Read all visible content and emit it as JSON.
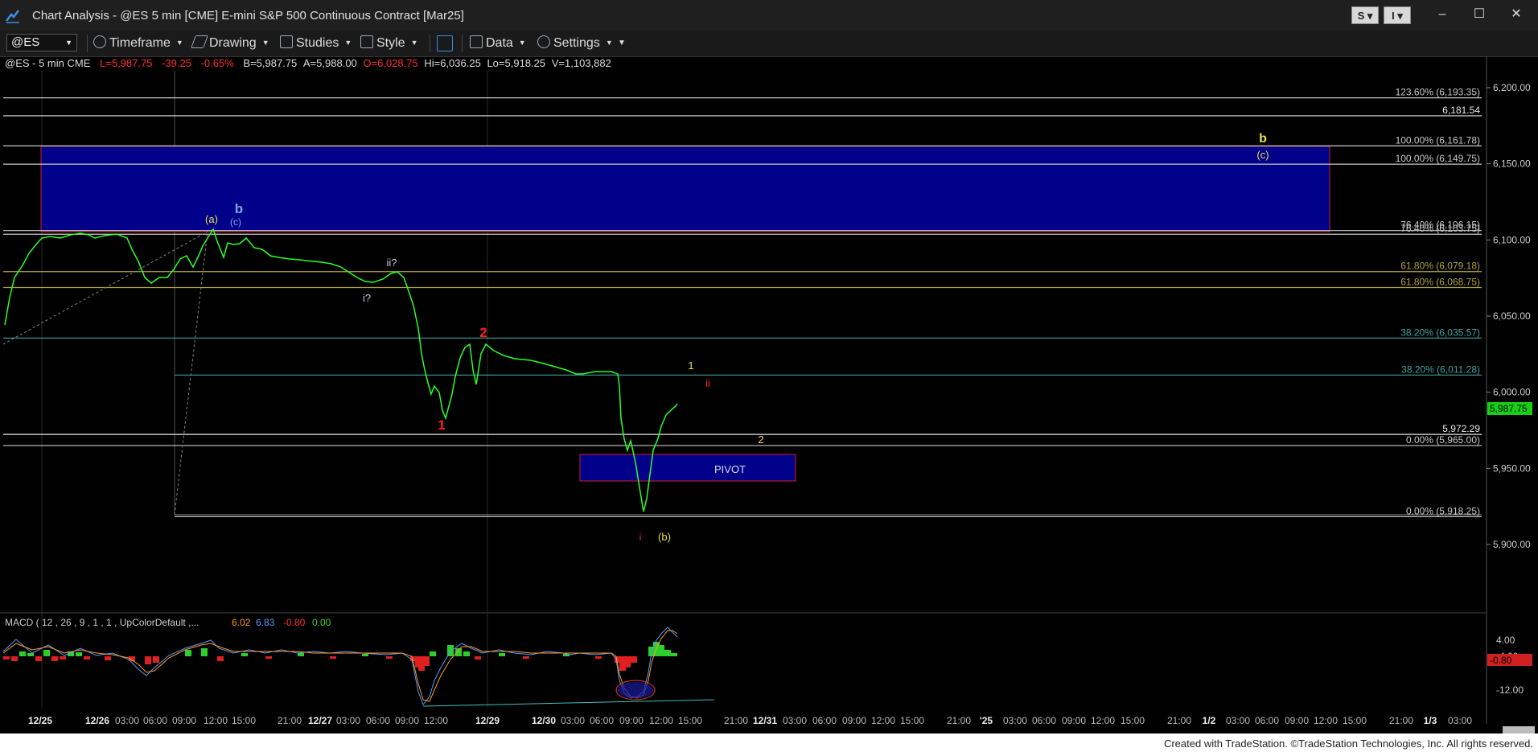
{
  "window": {
    "title": "Chart Analysis - @ES 5 min [CME] E-mini S&P 500 Continuous Contract [Mar25]",
    "btn_s": "S",
    "btn_i": "I",
    "min": "–",
    "max": "☐",
    "close": "✕"
  },
  "toolbar": {
    "symbol": "@ES",
    "timeframe": "Timeframe",
    "drawing": "Drawing",
    "studies": "Studies",
    "style": "Style",
    "data": "Data",
    "settings": "Settings"
  },
  "infobar": {
    "symbol": "@ES - 5 min  CME",
    "last": "L=5,987.75",
    "chg": "-39.25",
    "pct": "-0.65%",
    "bid": "B=5,987.75",
    "ask": "A=5,988.00",
    "open": "O=6,028.75",
    "hi": "Hi=6,036.25",
    "lo": "Lo=5,918.25",
    "vol": "V=1,103,882"
  },
  "colors": {
    "price": "#2bff2b",
    "blue_box": "#00008b",
    "red": "#ff2020",
    "yellow": "#e8e04a",
    "fib_text": "#c8c8c8"
  },
  "price_axis": {
    "ticks": [
      "6,200.00",
      "6,150.00",
      "6,100.00",
      "6,050.00",
      "6,000.00",
      "5,950.00",
      "5,900.00"
    ],
    "last_price": "5,987.75"
  },
  "fib_levels": [
    {
      "text": "123.60% (6,193.35)",
      "price": 6193.35,
      "color": "#c8c8c8"
    },
    {
      "text": "6,181.54",
      "price": 6181.54,
      "color": "#e8e8e8"
    },
    {
      "text": "100.00% (6,161.78)",
      "price": 6161.78,
      "color": "#c8c8c8"
    },
    {
      "text": "100.00% (6,149.75)",
      "price": 6149.75,
      "color": "#c8c8c8"
    },
    {
      "text": "76.40% (6,106.15)",
      "price": 6106.15,
      "color": "#c8c8c8"
    },
    {
      "text": "76.40% (6,103.75)",
      "price": 6103.75,
      "color": "#c8c8c8"
    },
    {
      "text": "61.80% (6,079.18)",
      "price": 6079.18,
      "color": "#b0a040"
    },
    {
      "text": "61.80% (6,068.75)",
      "price": 6068.75,
      "color": "#b0a040"
    },
    {
      "text": "38.20% (6,035.57)",
      "price": 6035.57,
      "color": "#40a0a0"
    },
    {
      "text": "38.20% (6,011.28)",
      "price": 6011.28,
      "color": "#40a0a0"
    },
    {
      "text": "5,972.29",
      "price": 5972.29,
      "color": "#e8e8e8"
    },
    {
      "text": "0.00% (5,965.00)",
      "price": 5965.0,
      "color": "#c8c8c8"
    },
    {
      "text": "0.00% (5,918.25)",
      "price": 5918.25,
      "color": "#c8c8c8"
    }
  ],
  "wave_labels": [
    {
      "text": "(a)",
      "color": "#e8e04a"
    },
    {
      "text": "b",
      "color": "#7fa8e0"
    },
    {
      "text": "(c)",
      "color": "#7fa8e0"
    },
    {
      "text": "ii?",
      "color": "#c8c8e8"
    },
    {
      "text": "i?",
      "color": "#c8c8e8"
    },
    {
      "text": "2",
      "color": "#ff2020"
    },
    {
      "text": "1",
      "color": "#ff2020"
    },
    {
      "text": "1",
      "color": "#e8e04a"
    },
    {
      "text": "ii",
      "color": "#ff2020"
    },
    {
      "text": "2",
      "color": "#e8e04a"
    },
    {
      "text": "i",
      "color": "#ff2020"
    },
    {
      "text": "(b)",
      "color": "#e8e04a"
    },
    {
      "text": "b",
      "color": "#e8e04a"
    },
    {
      "text": "(c)",
      "color": "#e8e04a"
    }
  ],
  "pivot": "PIVOT",
  "time_axis": [
    "12/25",
    "12/26",
    "03:00",
    "06:00",
    "09:00",
    "12:00",
    "15:00",
    "21:00",
    "12/27",
    "03:00",
    "06:00",
    "09:00",
    "12:00",
    "12/29",
    "12/30",
    "03:00",
    "06:00",
    "09:00",
    "12:00",
    "15:00",
    "21:00",
    "12/31",
    "03:00",
    "06:00",
    "09:00",
    "12:00",
    "15:00",
    "21:00",
    "'25",
    "03:00",
    "06:00",
    "09:00",
    "12:00",
    "15:00",
    "21:00",
    "1/2",
    "03:00",
    "06:00",
    "09:00",
    "12:00",
    "15:00",
    "21:00",
    "1/3",
    "03:00"
  ],
  "macd": {
    "label": "MACD ( 12 , 26 , 9 , 1 , 1 , UpColorDefault ,...",
    "v1": "6.02",
    "v2": "6.83",
    "v3": "-0.80",
    "v4": "0.00",
    "ticks": [
      "4.00",
      "-4.00",
      "-12.00"
    ],
    "last": "-0.80"
  },
  "footer": "Created with TradeStation. ©TradeStation Technologies, Inc. All rights reserved."
}
